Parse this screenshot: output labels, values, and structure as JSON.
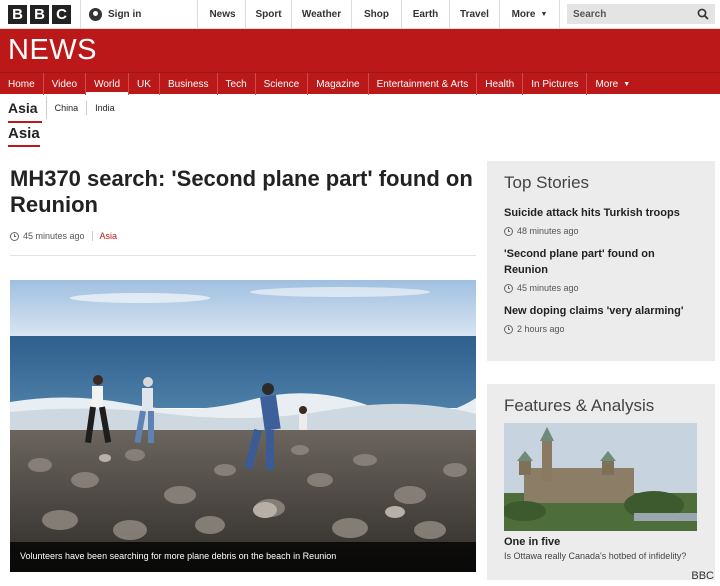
{
  "brand": {
    "letters": [
      "B",
      "B",
      "C"
    ]
  },
  "account": {
    "signin_label": "Sign in"
  },
  "top_nav": [
    "News",
    "Sport",
    "Weather",
    "Shop",
    "Earth",
    "Travel",
    "More"
  ],
  "search": {
    "placeholder": "Search"
  },
  "section_banner": {
    "title": "NEWS"
  },
  "main_nav": [
    "Home",
    "Video",
    "World",
    "UK",
    "Business",
    "Tech",
    "Science",
    "Magazine",
    "Entertainment & Arts",
    "Health",
    "In Pictures",
    "More"
  ],
  "active_main_nav": "World",
  "sub_nav": [
    "Asia",
    "China",
    "India"
  ],
  "section_label": "Asia",
  "article": {
    "headline": "MH370 search: 'Second plane part' found on Reunion",
    "time": "45 minutes ago",
    "tag": "Asia",
    "caption": "Volunteers have been searching for more plane debris on the beach in Reunion"
  },
  "top_stories": {
    "heading": "Top Stories",
    "items": [
      {
        "title": "Suicide attack hits Turkish troops",
        "time": "48 minutes ago"
      },
      {
        "title": "'Second plane part' found on Reunion",
        "time": "45 minutes ago"
      },
      {
        "title": "New doping claims 'very alarming'",
        "time": "2 hours ago"
      }
    ]
  },
  "features": {
    "heading": "Features & Analysis",
    "title": "One in five",
    "subtitle": "Is Ottawa really Canada's hotbed of infidelity?"
  },
  "credit": "BBC",
  "colors": {
    "brand_red": "#bb1919"
  }
}
